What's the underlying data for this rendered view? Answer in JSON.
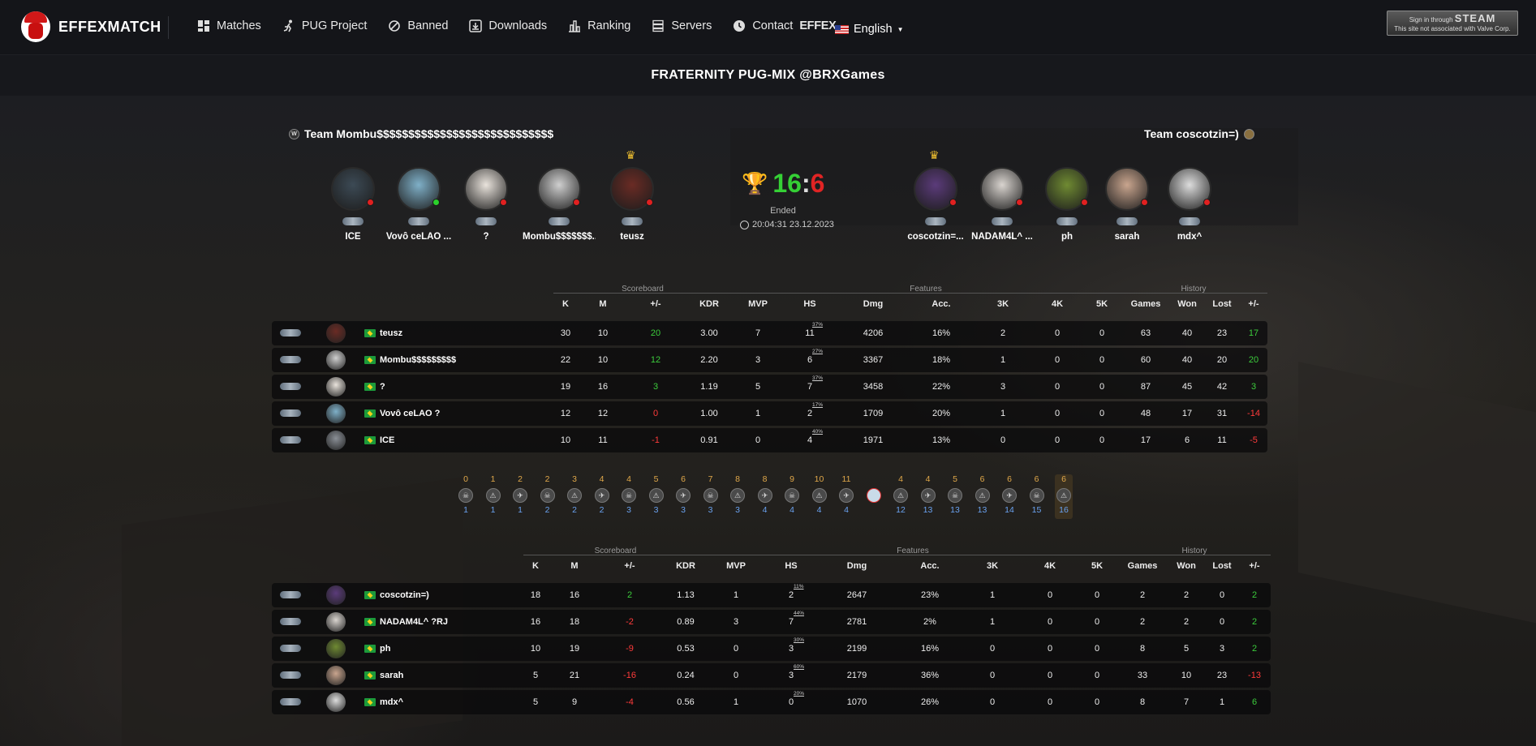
{
  "nav": {
    "logo_text": "EFFEXMATCH",
    "items": [
      {
        "label": "Matches",
        "icon": "dashboard-icon"
      },
      {
        "label": "PUG Project",
        "icon": "runner-icon"
      },
      {
        "label": "Banned",
        "icon": "ban-icon"
      },
      {
        "label": "Downloads",
        "icon": "download-icon"
      },
      {
        "label": "Ranking",
        "icon": "chart-icon"
      },
      {
        "label": "Servers",
        "icon": "server-icon"
      }
    ],
    "contact_label": "Contact",
    "contact_brand": "EFFEX",
    "language": "English",
    "steam_line1": "Sign in through",
    "steam_brand": "STEAM",
    "steam_line2": "This site not associated with Valve Corp."
  },
  "match": {
    "title": "FRATERNITY PUG-MIX @BRXGames",
    "status": "Ended",
    "datetime": "20:04:31 23.12.2023",
    "score_a": "16",
    "score_sep": ":",
    "score_b": "6"
  },
  "team_a": {
    "name": "Team Mombu$$$$$$$$$$$$$$$$$$$$$$$$$$$$",
    "icon_letter": "W",
    "players": [
      {
        "name": "ICE",
        "online": false
      },
      {
        "name": "Vovô ceLAO ...",
        "online": true
      },
      {
        "name": "?",
        "online": false
      },
      {
        "name": "Mombu$$$$$$$...",
        "online": false
      },
      {
        "name": "teusz",
        "online": false,
        "captain": true
      }
    ]
  },
  "team_b": {
    "name": "Team coscotzin=)",
    "players": [
      {
        "name": "coscotzin=...",
        "online": false,
        "captain": true
      },
      {
        "name": "NADAM4L^ ...",
        "online": false
      },
      {
        "name": "ph",
        "online": false
      },
      {
        "name": "sarah",
        "online": false
      },
      {
        "name": "mdx^",
        "online": false
      }
    ]
  },
  "group_labels": {
    "scoreboard": "Scoreboard",
    "features": "Features",
    "history": "History"
  },
  "headers": [
    "K",
    "M",
    "+/-",
    "KDR",
    "MVP",
    "HS",
    "Dmg",
    "Acc.",
    "3K",
    "4K",
    "5K",
    "Games",
    "Won",
    "Lost",
    "+/-"
  ],
  "scoreboard_a": [
    {
      "name": "teusz",
      "k": "30",
      "m": "10",
      "pm": "20",
      "kdr": "3.00",
      "mvp": "7",
      "hs": "11",
      "hsp": "37%",
      "dmg": "4206",
      "acc": "16%",
      "k3": "2",
      "k4": "0",
      "k5": "0",
      "games": "63",
      "won": "40",
      "lost": "23",
      "hpm": "17",
      "av": "#6a2b24"
    },
    {
      "name": "Mombu$$$$$$$$$",
      "k": "22",
      "m": "10",
      "pm": "12",
      "kdr": "2.20",
      "mvp": "3",
      "hs": "6",
      "hsp": "27%",
      "dmg": "3367",
      "acc": "18%",
      "k3": "1",
      "k4": "0",
      "k5": "0",
      "games": "60",
      "won": "40",
      "lost": "20",
      "hpm": "20",
      "av": "#cfcfcf"
    },
    {
      "name": "?",
      "k": "19",
      "m": "16",
      "pm": "3",
      "kdr": "1.19",
      "mvp": "5",
      "hs": "7",
      "hsp": "37%",
      "dmg": "3458",
      "acc": "22%",
      "k3": "3",
      "k4": "0",
      "k5": "0",
      "games": "87",
      "won": "45",
      "lost": "42",
      "hpm": "3",
      "av": "#e9e3dc"
    },
    {
      "name": "Vovô ceLAO ?",
      "k": "12",
      "m": "12",
      "pm": "0",
      "kdr": "1.00",
      "mvp": "1",
      "hs": "2",
      "hsp": "17%",
      "dmg": "1709",
      "acc": "20%",
      "k3": "1",
      "k4": "0",
      "k5": "0",
      "games": "48",
      "won": "17",
      "lost": "31",
      "hpm": "-14",
      "av": "#7fb0c8"
    },
    {
      "name": "ICE",
      "k": "10",
      "m": "11",
      "pm": "-1",
      "kdr": "0.91",
      "mvp": "0",
      "hs": "4",
      "hsp": "40%",
      "dmg": "1971",
      "acc": "13%",
      "k3": "0",
      "k4": "0",
      "k5": "0",
      "games": "17",
      "won": "6",
      "lost": "11",
      "hpm": "-5",
      "av": "#8a8f96"
    }
  ],
  "scoreboard_b": [
    {
      "name": "coscotzin=)",
      "k": "18",
      "m": "16",
      "pm": "2",
      "kdr": "1.13",
      "mvp": "1",
      "hs": "2",
      "hsp": "11%",
      "dmg": "2647",
      "acc": "23%",
      "k3": "1",
      "k4": "0",
      "k5": "0",
      "games": "2",
      "won": "2",
      "lost": "0",
      "hpm": "2",
      "av": "#5b3b7a"
    },
    {
      "name": "NADAM4L^ ?RJ",
      "k": "16",
      "m": "18",
      "pm": "-2",
      "kdr": "0.89",
      "mvp": "3",
      "hs": "7",
      "hsp": "44%",
      "dmg": "2781",
      "acc": "2%",
      "k3": "1",
      "k4": "0",
      "k5": "0",
      "games": "2",
      "won": "2",
      "lost": "0",
      "hpm": "2",
      "av": "#d9d4cf"
    },
    {
      "name": "ph",
      "k": "10",
      "m": "19",
      "pm": "-9",
      "kdr": "0.53",
      "mvp": "0",
      "hs": "3",
      "hsp": "30%",
      "dmg": "2199",
      "acc": "16%",
      "k3": "0",
      "k4": "0",
      "k5": "0",
      "games": "8",
      "won": "5",
      "lost": "3",
      "hpm": "2",
      "av": "#6f8a32"
    },
    {
      "name": "sarah",
      "k": "5",
      "m": "21",
      "pm": "-16",
      "kdr": "0.24",
      "mvp": "0",
      "hs": "3",
      "hsp": "60%",
      "dmg": "2179",
      "acc": "36%",
      "k3": "0",
      "k4": "0",
      "k5": "0",
      "games": "33",
      "won": "10",
      "lost": "23",
      "hpm": "-13",
      "av": "#c9a58e"
    },
    {
      "name": "mdx^",
      "k": "5",
      "m": "9",
      "pm": "-4",
      "kdr": "0.56",
      "mvp": "1",
      "hs": "0",
      "hsp": "20%",
      "dmg": "1070",
      "acc": "26%",
      "k3": "0",
      "k4": "0",
      "k5": "0",
      "games": "8",
      "won": "7",
      "lost": "1",
      "hpm": "6",
      "av": "#ddd"
    }
  ],
  "rounds": {
    "top": [
      "0",
      "1",
      "2",
      "2",
      "3",
      "4",
      "4",
      "5",
      "6",
      "7",
      "8",
      "8",
      "9",
      "10",
      "11",
      "",
      "4",
      "4",
      "5",
      "6",
      "6",
      "6",
      "6"
    ],
    "bottom": [
      "1",
      "1",
      "1",
      "2",
      "2",
      "2",
      "3",
      "3",
      "3",
      "3",
      "3",
      "4",
      "4",
      "4",
      "4",
      "",
      "12",
      "13",
      "13",
      "13",
      "14",
      "15",
      "16"
    ]
  },
  "colors": {
    "win": "#35d035",
    "lose": "#e02424",
    "accent": "#e0a84a"
  }
}
